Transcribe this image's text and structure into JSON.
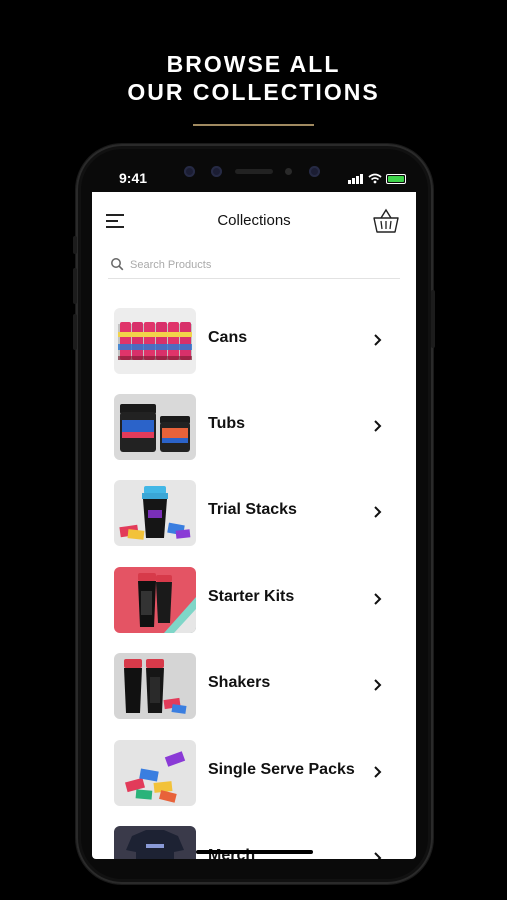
{
  "promo": {
    "line1": "BROWSE ALL",
    "line2": "OUR COLLECTIONS"
  },
  "status_bar": {
    "time": "9:41",
    "battery_color": "#3fd34b"
  },
  "header": {
    "title": "Collections",
    "menu_icon": "hamburger-menu-icon",
    "cart_icon": "basket-icon"
  },
  "search": {
    "placeholder": "Search Products",
    "icon": "search-icon"
  },
  "collections": [
    {
      "label": "Cans",
      "thumb": "cans-image"
    },
    {
      "label": "Tubs",
      "thumb": "tubs-image"
    },
    {
      "label": "Trial Stacks",
      "thumb": "trial-stacks-image"
    },
    {
      "label": "Starter Kits",
      "thumb": "starter-kits-image"
    },
    {
      "label": "Shakers",
      "thumb": "shakers-image"
    },
    {
      "label": "Single Serve Packs",
      "thumb": "single-serve-packs-image"
    },
    {
      "label": "Merch",
      "thumb": "merch-image"
    }
  ],
  "colors": {
    "accent_rule": "#a08a60",
    "page_background": "#000000",
    "screen_background": "#ffffff"
  }
}
